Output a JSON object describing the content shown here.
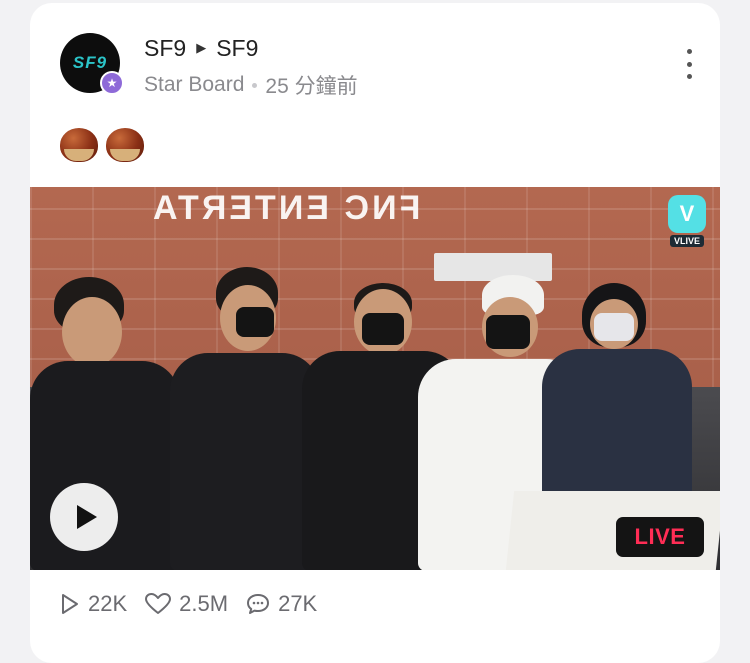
{
  "post": {
    "channel": "SF9",
    "board_channel": "SF9",
    "board_name": "Star Board",
    "time_ago": "25 分鐘前",
    "avatar_text": "SF9",
    "content_emoji": "🌰🌰"
  },
  "video": {
    "wall_text": "FNC ENTERTA",
    "live_label": "LIVE",
    "vlive_label": "VLIVE"
  },
  "stats": {
    "views": "22K",
    "likes": "2.5M",
    "comments": "27K"
  },
  "colors": {
    "live": "#ff2d55",
    "badge": "#8e6ad8",
    "vlive": "#54e0e5"
  },
  "icons": [
    "play-icon",
    "heart-icon",
    "comment-icon",
    "more-icon",
    "star-icon"
  ]
}
